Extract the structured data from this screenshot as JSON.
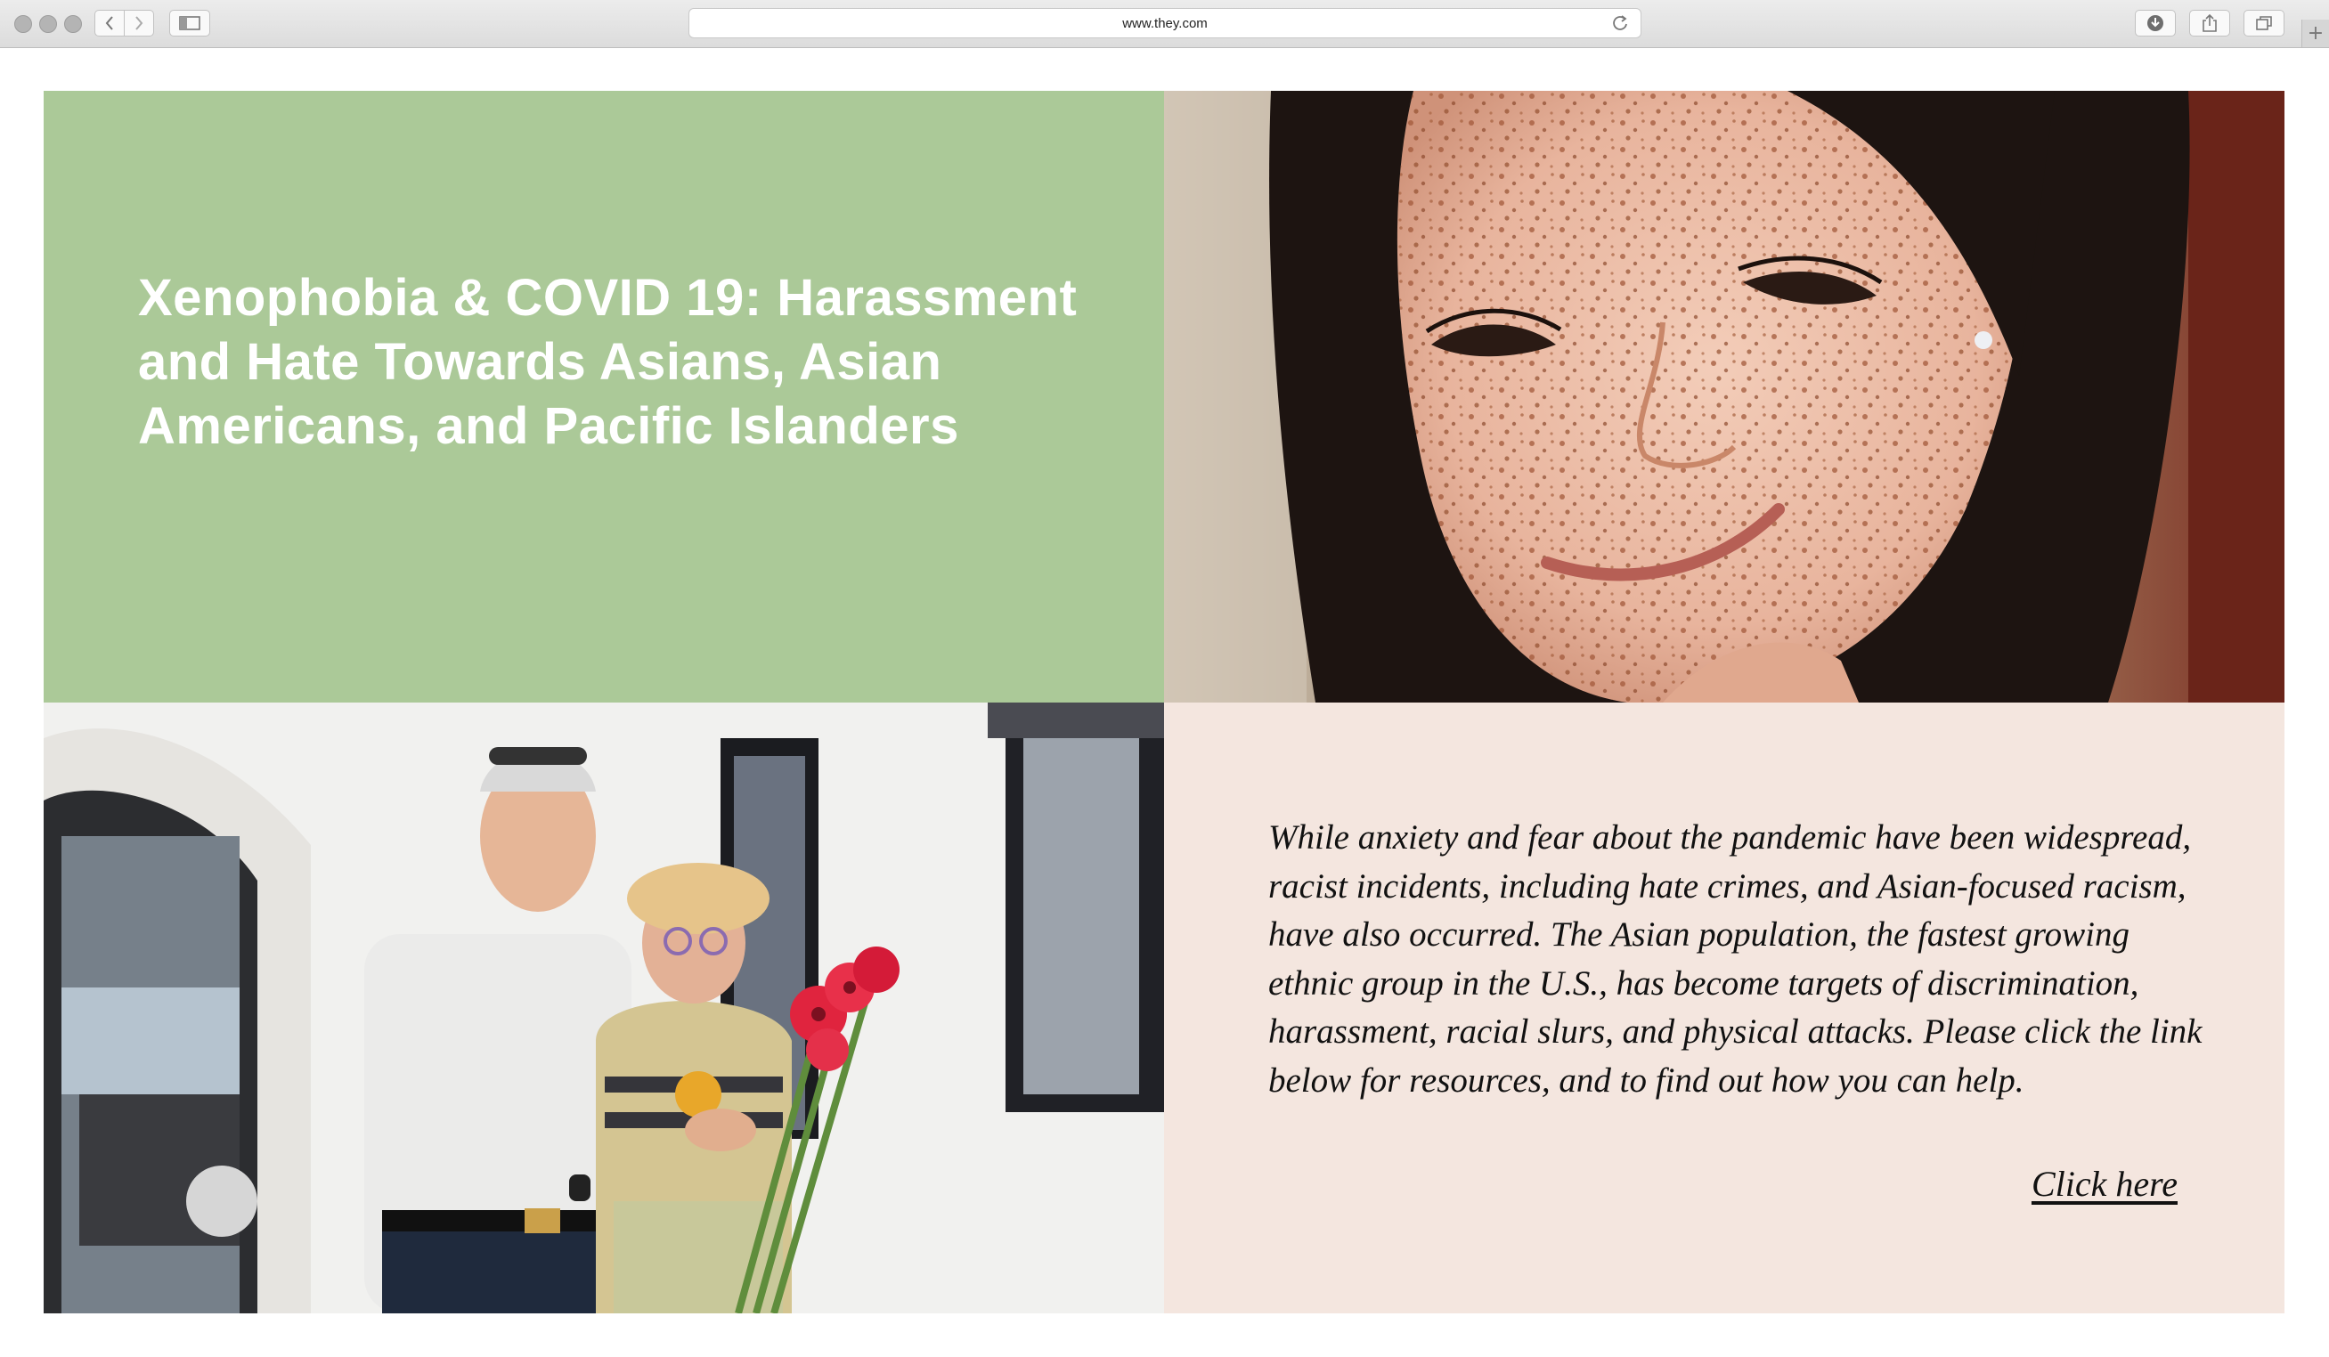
{
  "browser": {
    "url": "www.they.com",
    "new_tab_symbol": "+"
  },
  "hero": {
    "title": "Xenophobia & COVID 19: Harassment and Hate Towards Asians, Asian Americans, and Pacific Islanders",
    "title_bg": "#abc998"
  },
  "images": {
    "portrait": "photo-young-woman-freckles",
    "couple": "photo-elderly-couple-with-flowers"
  },
  "info": {
    "body": "While anxiety and fear about the pandemic have been widespread, racist incidents, including hate crimes, and Asian-focused racism, have also occurred. The Asian population, the fastest growing ethnic group in the U.S., has become targets of discrimination, harassment, racial slurs, and physical attacks. Please click the link below for resources, and to find out how you can help.",
    "link_label": "Click here",
    "bg": "#f4e6df"
  }
}
